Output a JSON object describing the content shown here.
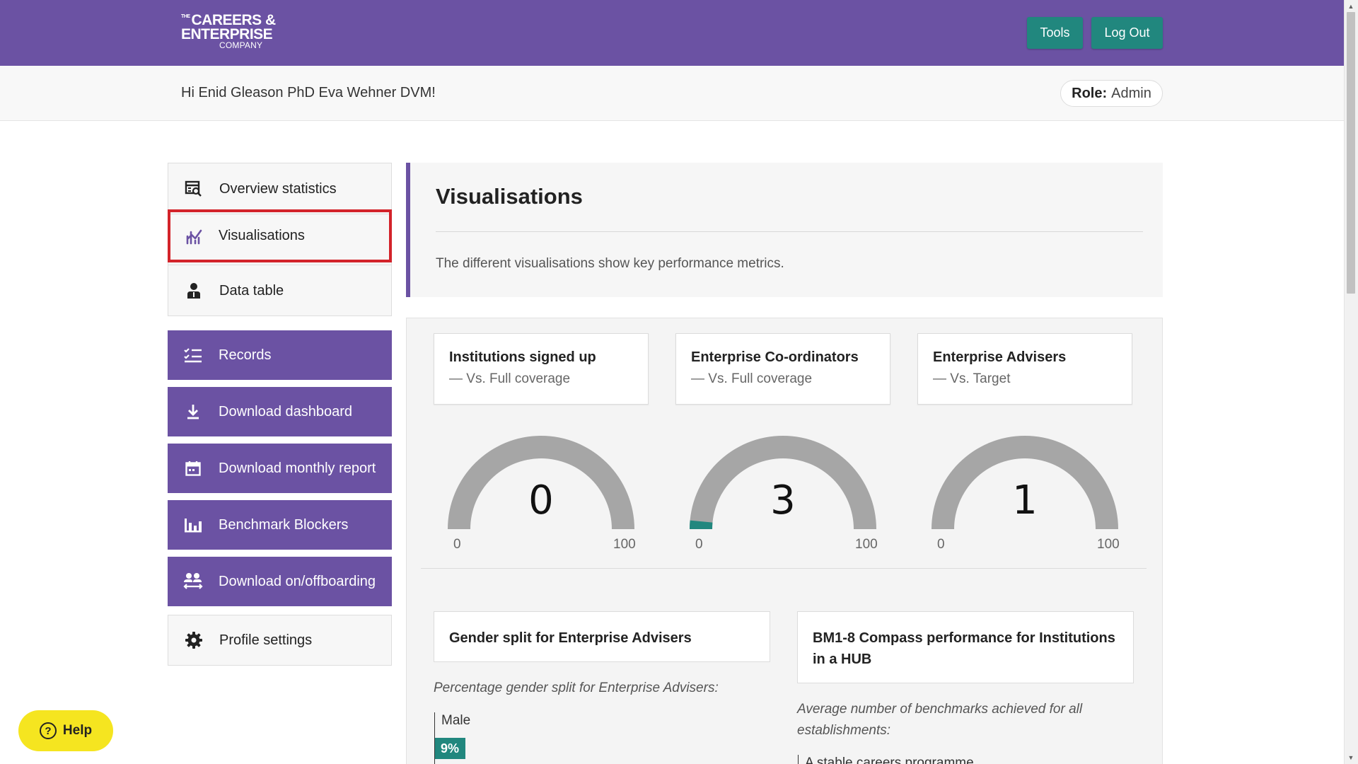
{
  "header": {
    "logo": {
      "the": "THE",
      "line1": "CAREERS &",
      "line2": "ENTERPRISE",
      "line3": "COMPANY"
    },
    "tools_label": "Tools",
    "logout_label": "Log Out"
  },
  "subheader": {
    "greeting": "Hi Enid Gleason PhD Eva Wehner DVM!",
    "role_label": "Role:",
    "role_value": "Admin"
  },
  "sidebar": {
    "nav": [
      {
        "label": "Overview statistics",
        "icon": "overview-search-icon"
      },
      {
        "label": "Visualisations",
        "icon": "chart-icon",
        "active": true
      },
      {
        "label": "Data table",
        "icon": "person-icon"
      }
    ],
    "actions": [
      {
        "label": "Records",
        "icon": "checklist-icon"
      },
      {
        "label": "Download dashboard",
        "icon": "download-icon"
      },
      {
        "label": "Download monthly report",
        "icon": "calendar-icon"
      },
      {
        "label": "Benchmark Blockers",
        "icon": "bar-chart-icon"
      },
      {
        "label": "Download on/offboarding",
        "icon": "people-swap-icon"
      }
    ],
    "settings_label": "Profile settings"
  },
  "help_label": "Help",
  "intro": {
    "title": "Visualisations",
    "description": "The different visualisations show key performance metrics."
  },
  "gauges": [
    {
      "title": "Institutions signed up",
      "subtitle": "— Vs. Full coverage",
      "value": "0",
      "min": "0",
      "max": "100"
    },
    {
      "title": "Enterprise Co-ordinators",
      "subtitle": "— Vs. Full coverage",
      "value": "3",
      "min": "0",
      "max": "100"
    },
    {
      "title": "Enterprise Advisers",
      "subtitle": "— Vs. Target",
      "value": "1",
      "min": "0",
      "max": "100"
    }
  ],
  "gender_card": {
    "title": "Gender split for Enterprise Advisers",
    "caption": "Percentage gender split for Enterprise Advisers:",
    "bars": [
      {
        "label": "Male",
        "value": "9%"
      }
    ]
  },
  "bm_card": {
    "title": "BM1-8 Compass performance for Institutions in a HUB",
    "caption": "Average number of benchmarks achieved for all establishments:",
    "first_item": "A stable careers programme"
  },
  "colors": {
    "brand_purple": "#6b52a3",
    "teal": "#21877e",
    "highlight_red": "#d3232a",
    "help_yellow": "#f5e520",
    "gauge_grey": "#a6a6a6"
  }
}
